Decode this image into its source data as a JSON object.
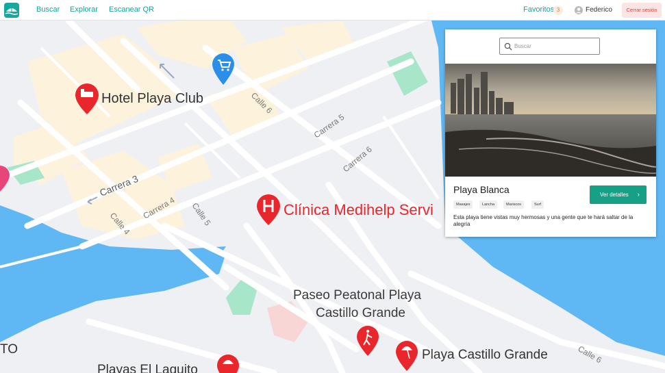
{
  "nav": {
    "links": [
      "Buscar",
      "Explorar",
      "Escanear QR"
    ],
    "favorites_label": "Favoritos",
    "favorites_count": "3",
    "user_name": "Federico",
    "logout_label": "Cerrar sesión"
  },
  "map": {
    "pois": {
      "hotel": "Hotel Playa Club",
      "clinic": "Clínica Medihelp Servi",
      "paseo_line1": "Paseo Peatonal Playa",
      "paseo_line2": "Castillo Grande",
      "castillo": "Playa Castillo Grande",
      "laguito": "Playas El Laguito",
      "edge_left": "TO"
    },
    "streets": {
      "calle6_a": "Calle 6",
      "calle6_b": "Calle 6",
      "carrera5": "Carrera 5",
      "carrera6": "Carrera 6",
      "carrera3": "Carrera 3",
      "carrera4": "Carrera 4",
      "calle5": "Calle 5",
      "calle4": "Calle 4"
    },
    "colors": {
      "water": "#5fb7f3",
      "land": "#eef0f3",
      "road": "#ffffff",
      "urban": "#fdf3dc",
      "park": "#a8e6c9",
      "marker_red": "#e8262b",
      "marker_blue": "#2b8ee8"
    }
  },
  "card": {
    "search_placeholder": "Buscar",
    "title": "Playa Blanca",
    "details_button": "Ver detalles",
    "tags": [
      "Masajes",
      "Lancha",
      "Mariscos",
      "Surf"
    ],
    "description": "Esta playa tiene vistas muy hermosas y una gente que te hará saltar de la alegría"
  },
  "theme": {
    "accent": "#16a085",
    "logout_bg": "#fbe4e4"
  }
}
